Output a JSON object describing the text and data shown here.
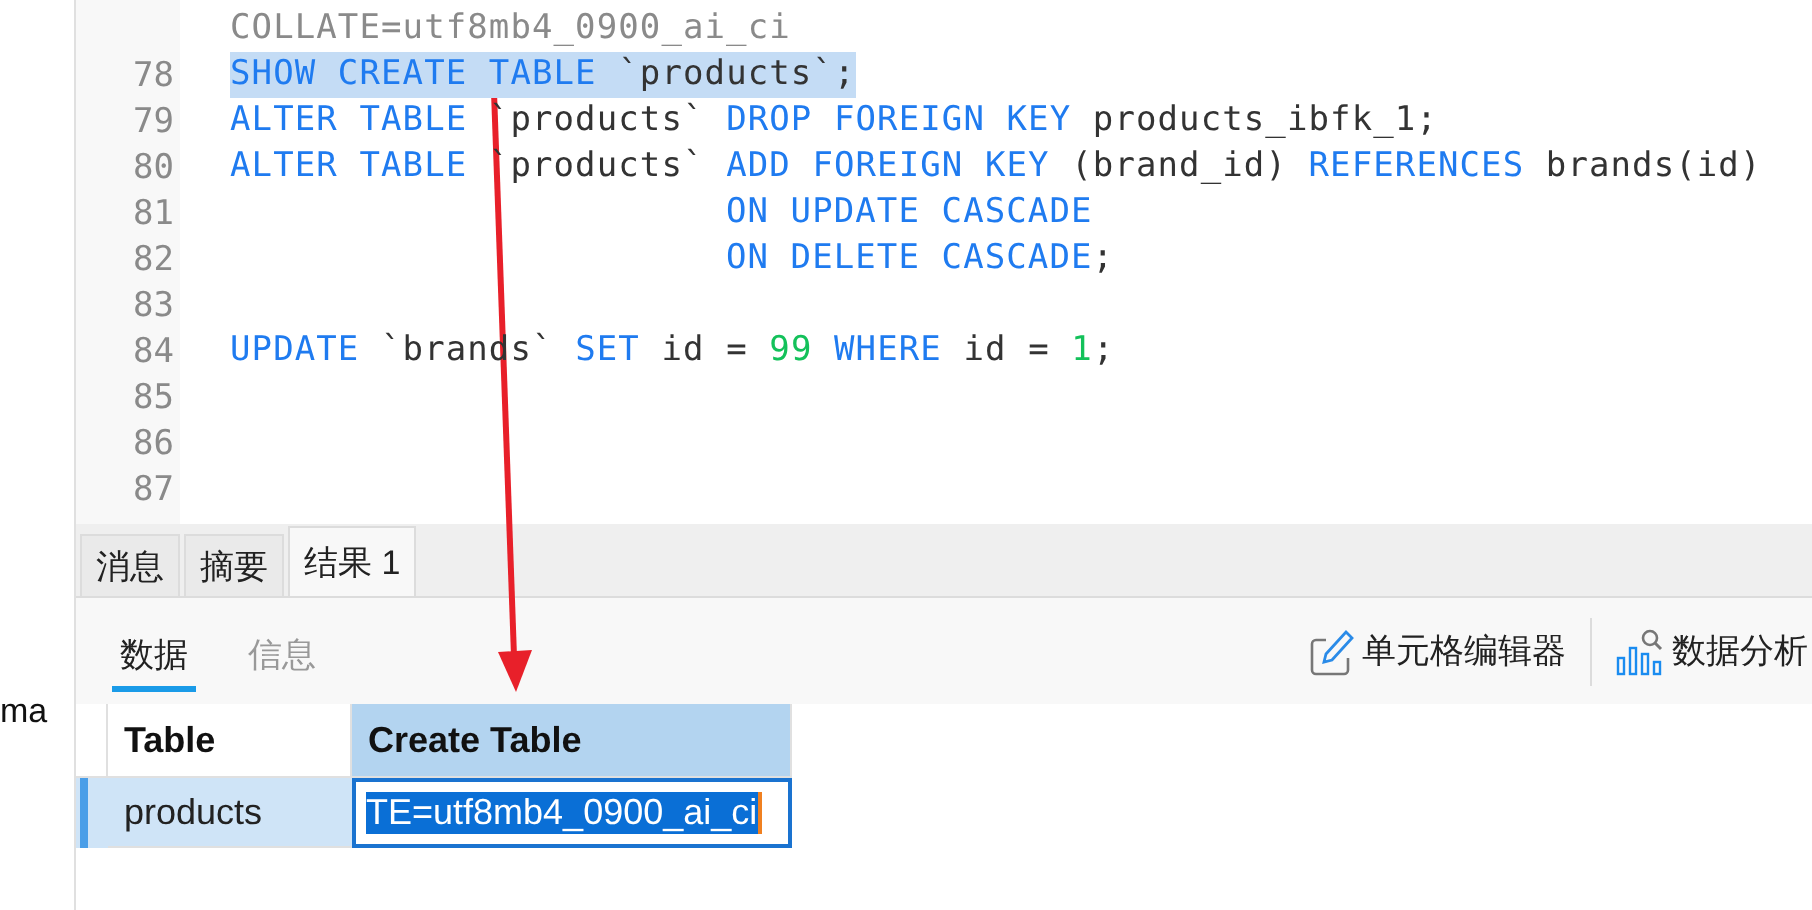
{
  "sidebar_fragment": "ma",
  "editor": {
    "lines": [
      {
        "tokens": [
          {
            "kind": "muted",
            "text": "COLLATE=utf8mb4_0900_ai_ci"
          }
        ],
        "selected": false
      },
      {
        "number": "78",
        "selected": true,
        "tokens": [
          {
            "kind": "keyword",
            "text": "SHOW CREATE TABLE "
          },
          {
            "kind": "ident",
            "text": "`products`"
          },
          {
            "kind": "ident",
            "text": ";"
          }
        ]
      },
      {
        "number": "79",
        "selected": false,
        "tokens": [
          {
            "kind": "keyword",
            "text": "ALTER TABLE "
          },
          {
            "kind": "ident",
            "text": "`products` "
          },
          {
            "kind": "keyword",
            "text": "DROP FOREIGN KEY "
          },
          {
            "kind": "ident",
            "text": "products_ibfk_1;"
          }
        ]
      },
      {
        "number": "80",
        "selected": false,
        "tokens": [
          {
            "kind": "keyword",
            "text": "ALTER TABLE "
          },
          {
            "kind": "ident",
            "text": "`products` "
          },
          {
            "kind": "keyword",
            "text": "ADD FOREIGN KEY "
          },
          {
            "kind": "ident",
            "text": "(brand_id) "
          },
          {
            "kind": "keyword",
            "text": "REFERENCES "
          },
          {
            "kind": "ident",
            "text": "brands(id)"
          }
        ]
      },
      {
        "number": "81",
        "selected": false,
        "continuation": true,
        "tokens": [
          {
            "kind": "keyword",
            "text": "ON UPDATE CASCADE"
          }
        ]
      },
      {
        "number": "82",
        "selected": false,
        "continuation": true,
        "tokens": [
          {
            "kind": "keyword",
            "text": "ON DELETE CASCADE"
          },
          {
            "kind": "ident",
            "text": ";"
          }
        ]
      },
      {
        "number": "83"
      },
      {
        "number": "84",
        "selected": false,
        "tokens": [
          {
            "kind": "keyword",
            "text": "UPDATE "
          },
          {
            "kind": "ident",
            "text": "`brands` "
          },
          {
            "kind": "keyword",
            "text": "SET "
          },
          {
            "kind": "ident",
            "text": "id = "
          },
          {
            "kind": "number",
            "text": "99"
          },
          {
            "kind": "keyword",
            "text": " WHERE "
          },
          {
            "kind": "ident",
            "text": "id = "
          },
          {
            "kind": "number",
            "text": "1"
          },
          {
            "kind": "ident",
            "text": ";"
          }
        ]
      },
      {
        "number": "85"
      },
      {
        "number": "86"
      },
      {
        "number": "87"
      }
    ]
  },
  "result_tabs": [
    {
      "label": "消息",
      "selected": false
    },
    {
      "label": "摘要",
      "selected": false
    },
    {
      "label": "结果 1",
      "selected": true
    }
  ],
  "view_tabs": [
    {
      "label": "数据",
      "selected": true
    },
    {
      "label": "信息",
      "selected": false
    }
  ],
  "toolbar": [
    {
      "kind": "edit",
      "label": "单元格编辑器"
    },
    {
      "kind": "analyze",
      "label": "数据分析"
    }
  ],
  "table": {
    "columns": [
      {
        "label": "Table",
        "selected": false
      },
      {
        "label": "Create Table",
        "selected": true
      }
    ],
    "rows": [
      {
        "selected": true,
        "cells": [
          {
            "text": "products",
            "editing": false
          },
          {
            "text": "TE=utf8mb4_0900_ai_ci",
            "editing": true
          }
        ]
      }
    ]
  }
}
